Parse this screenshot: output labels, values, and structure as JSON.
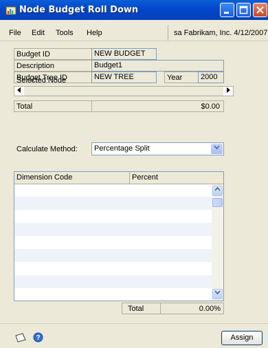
{
  "window": {
    "title": "Node Budget Roll Down"
  },
  "menu": {
    "items": [
      "File",
      "Edit",
      "Tools",
      "Help"
    ],
    "company_info": "sa  Fabrikam, Inc.  4/12/2007"
  },
  "form": {
    "budget_id_label": "Budget ID",
    "budget_id_value": "NEW BUDGET",
    "description_label": "Description",
    "description_value": "Budget1",
    "budget_tree_id_label": "Budget Tree ID",
    "budget_tree_id_value": "NEW TREE",
    "year_label": "Year",
    "year_value": "2000",
    "selected_node_label": "Selected Node",
    "total_label": "Total",
    "total_value": "$0.00",
    "calc_method_label": "Calculate Method:",
    "calc_method_value": "Percentage Split"
  },
  "grid": {
    "columns": [
      "Dimension Code",
      "Percent"
    ],
    "rows": [],
    "total_label": "Total",
    "total_percent": "0.00%"
  },
  "footer": {
    "assign_label": "Assign"
  },
  "icons": [
    "app-icon",
    "minimize-icon",
    "maximize-icon",
    "close-icon",
    "note-icon",
    "help-icon"
  ]
}
